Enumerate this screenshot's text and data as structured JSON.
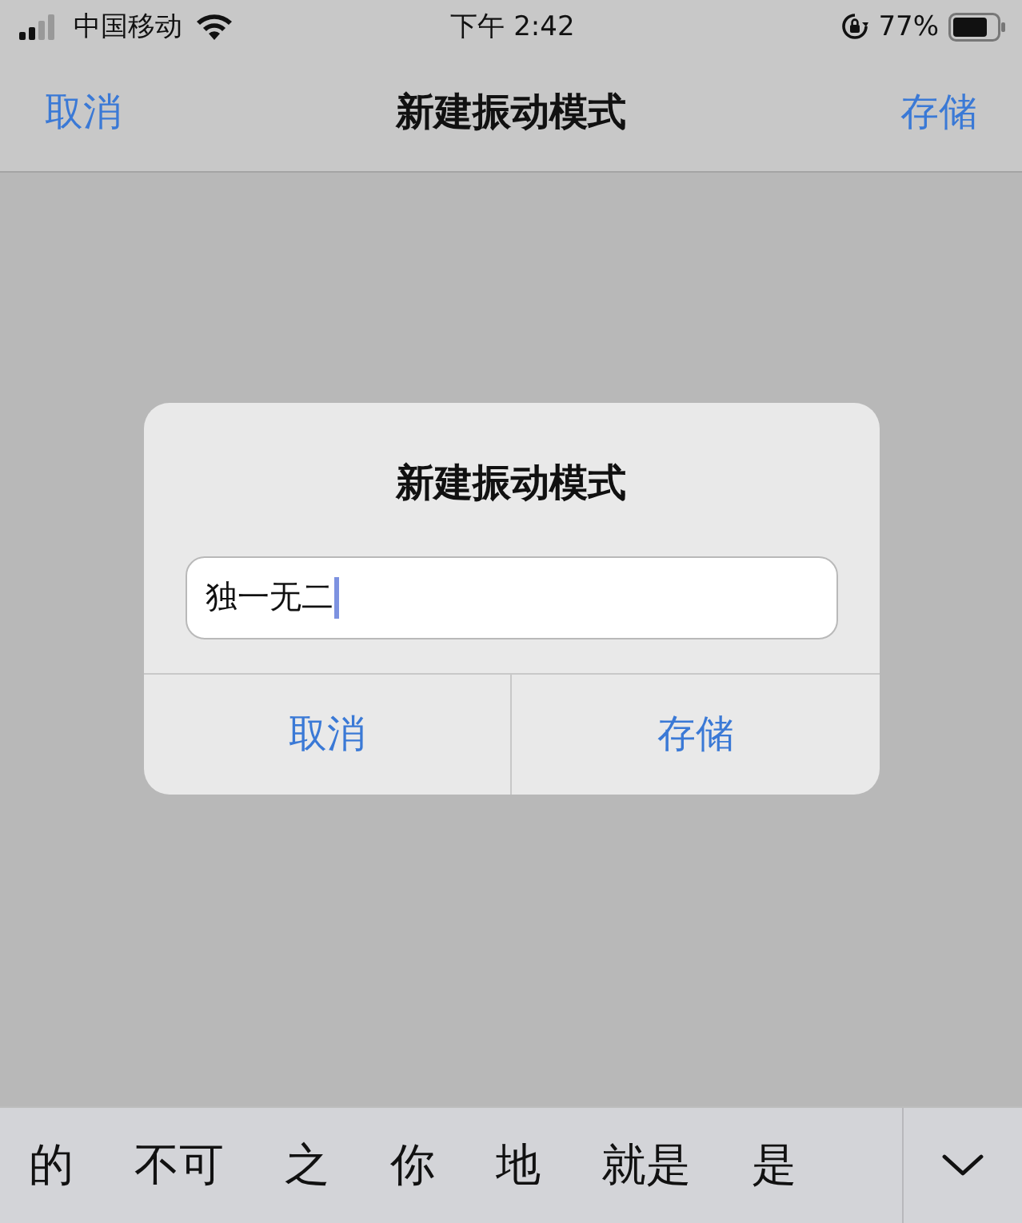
{
  "status_bar": {
    "carrier": "中国移动",
    "time": "下午 2:42",
    "battery_percent": "77%"
  },
  "nav_bar": {
    "left_button": "取消",
    "title": "新建振动模式",
    "right_button": "存储"
  },
  "dialog": {
    "title": "新建振动模式",
    "field": {
      "value": "独一无二"
    },
    "buttons": [
      {
        "label": "取消"
      },
      {
        "label": "存储"
      }
    ]
  },
  "candidates": [
    "的",
    "不可",
    "之",
    "你",
    "地",
    "就是",
    "是"
  ]
}
